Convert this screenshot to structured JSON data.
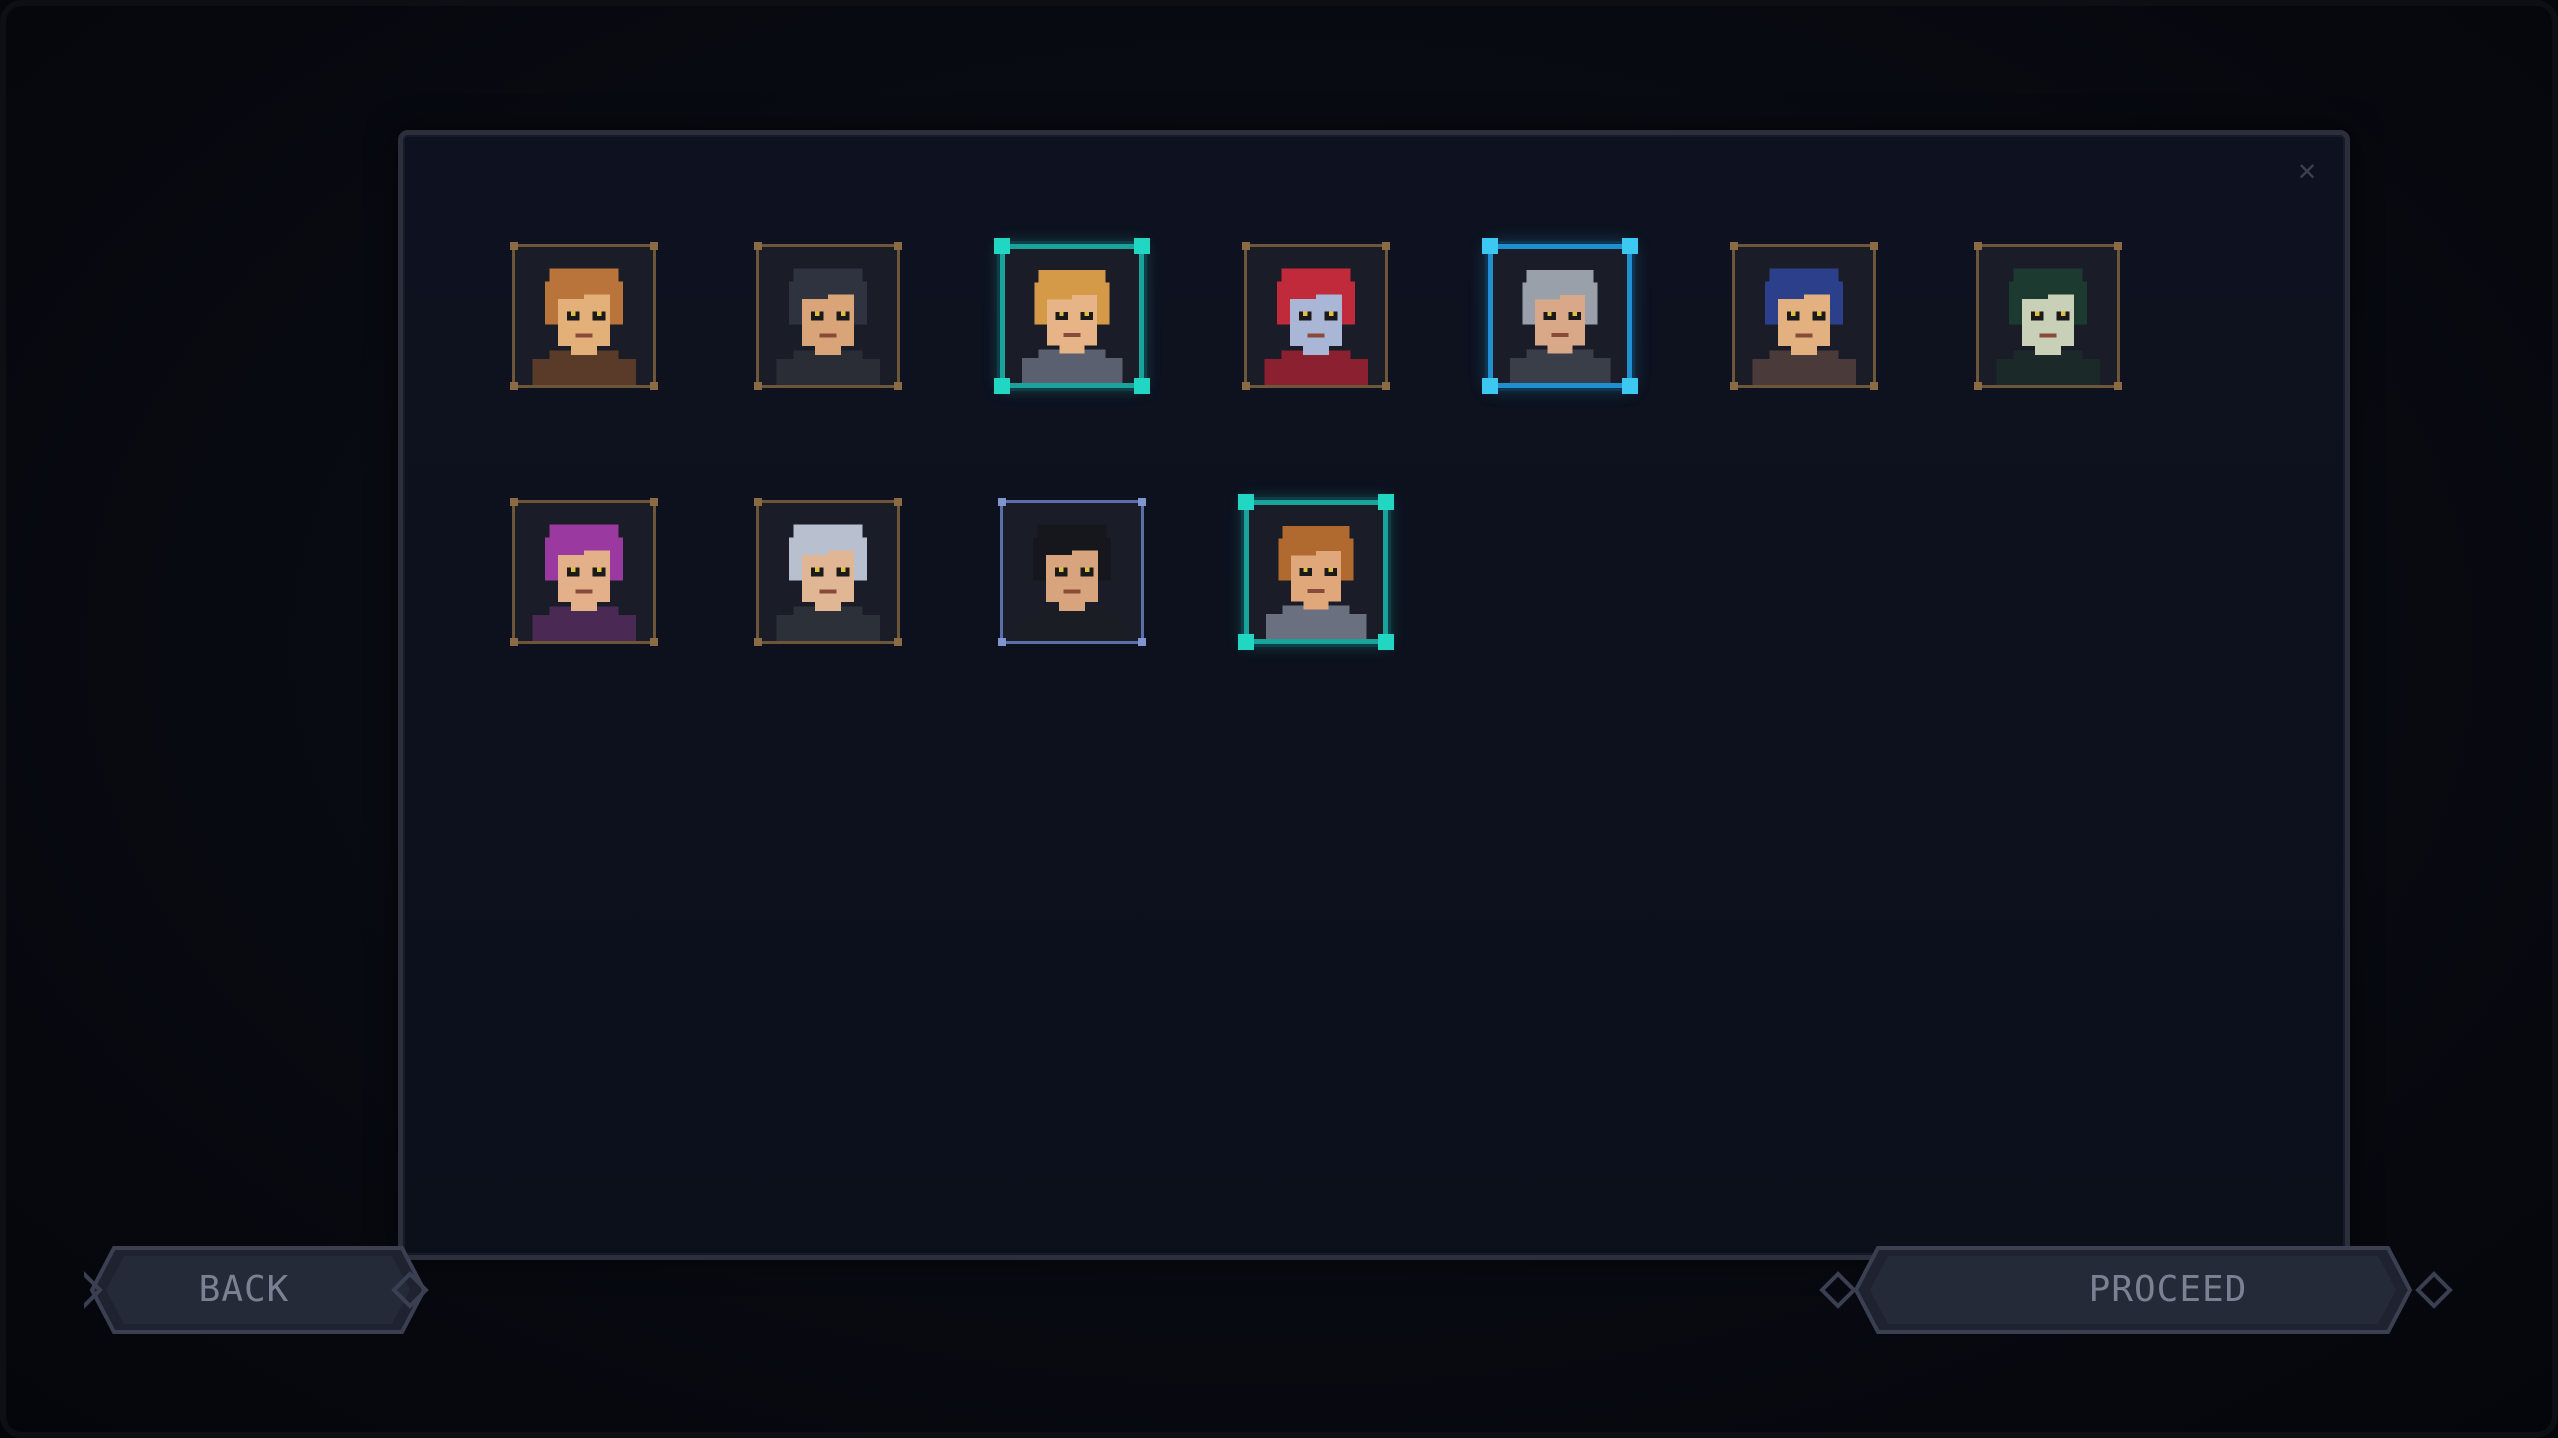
{
  "dialog": {
    "close_glyph": "✕"
  },
  "portraits": [
    {
      "name": "brown-hair-youth",
      "hair": "#b8743a",
      "skin": "#e3b07a",
      "cloth": "#5a3a28",
      "state": "normal"
    },
    {
      "name": "dark-hair-scarred",
      "hair": "#2f3340",
      "skin": "#d9a578",
      "cloth": "#2a2c36",
      "state": "normal"
    },
    {
      "name": "blonde-man",
      "hair": "#d59a48",
      "skin": "#e7b487",
      "cloth": "#5a6070",
      "state": "selected"
    },
    {
      "name": "red-hair-elf",
      "hair": "#c02a3a",
      "skin": "#a9b6d6",
      "cloth": "#8a2030",
      "state": "normal"
    },
    {
      "name": "grey-bearded-elder",
      "hair": "#9aa0aa",
      "skin": "#d8a888",
      "cloth": "#3a3e48",
      "state": "selected-blue"
    },
    {
      "name": "blue-hair-masked",
      "hair": "#2c3f8a",
      "skin": "#e3b080",
      "cloth": "#4a3a3a",
      "state": "normal"
    },
    {
      "name": "green-hair-elf",
      "hair": "#1d3a30",
      "skin": "#c8d0b8",
      "cloth": "#1b2a28",
      "state": "normal"
    },
    {
      "name": "purple-hair-girl",
      "hair": "#9a3aa0",
      "skin": "#e3b08a",
      "cloth": "#4a2a55",
      "state": "normal"
    },
    {
      "name": "silver-hair-youth",
      "hair": "#b8c0d0",
      "skin": "#e0b694",
      "cloth": "#2c3038",
      "state": "normal"
    },
    {
      "name": "black-hair-swordsman",
      "hair": "#15171d",
      "skin": "#d8a47e",
      "cloth": "#1b1d24",
      "state": "hover"
    },
    {
      "name": "auburn-hair-man",
      "hair": "#b06a30",
      "skin": "#e0a87a",
      "cloth": "#6a7080",
      "state": "selected"
    }
  ],
  "buttons": {
    "back_label": "BACK",
    "proceed_label": "PROCEED"
  },
  "colors": {
    "frame_normal": "#6c5538",
    "frame_selected": "#1aa39a",
    "frame_selected_blue": "#1f8fd0",
    "button_fill": "#252a38",
    "button_text": "#7b8193"
  }
}
